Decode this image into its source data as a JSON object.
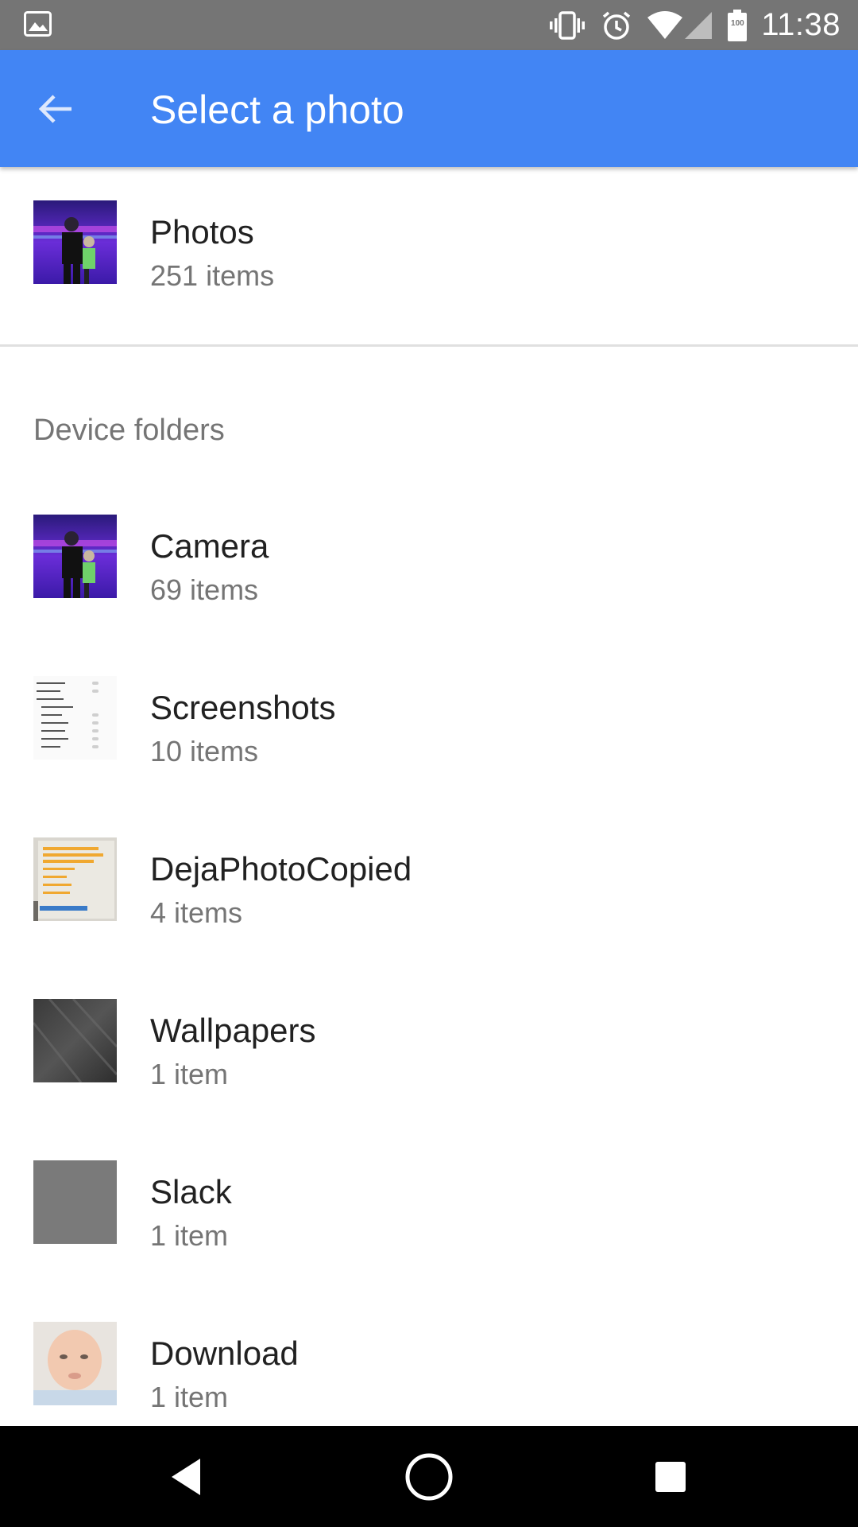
{
  "status_bar": {
    "time": "11:38",
    "battery_level": "100",
    "icons": [
      "gallery-icon",
      "vibrate-icon",
      "alarm-icon",
      "wifi-icon",
      "cell-signal-icon",
      "battery-icon"
    ]
  },
  "app_bar": {
    "back_icon": "arrow-back-icon",
    "title": "Select a photo"
  },
  "top_album": {
    "title": "Photos",
    "count": "251 items",
    "thumbnail": "bowling-photo"
  },
  "section_header": "Device folders",
  "folders": [
    {
      "title": "Camera",
      "count": "69 items",
      "thumbnail": "bowling-photo"
    },
    {
      "title": "Screenshots",
      "count": "10 items",
      "thumbnail": "settings-screenshot"
    },
    {
      "title": "DejaPhotoCopied",
      "count": "4 items",
      "thumbnail": "flyer-photo"
    },
    {
      "title": "Wallpapers",
      "count": "1 item",
      "thumbnail": "dark-texture"
    },
    {
      "title": "Slack",
      "count": "1 item",
      "thumbnail": "gray-square"
    },
    {
      "title": "Download",
      "count": "1 item",
      "thumbnail": "baby-photo"
    }
  ],
  "nav_bar": {
    "icons": [
      "back-triangle-icon",
      "home-circle-icon",
      "recents-square-icon"
    ]
  },
  "colors": {
    "status_bar": "#757575",
    "app_bar": "#4285f4",
    "nav_bar": "#000000",
    "primary_text": "#212121",
    "secondary_text": "#757575"
  }
}
